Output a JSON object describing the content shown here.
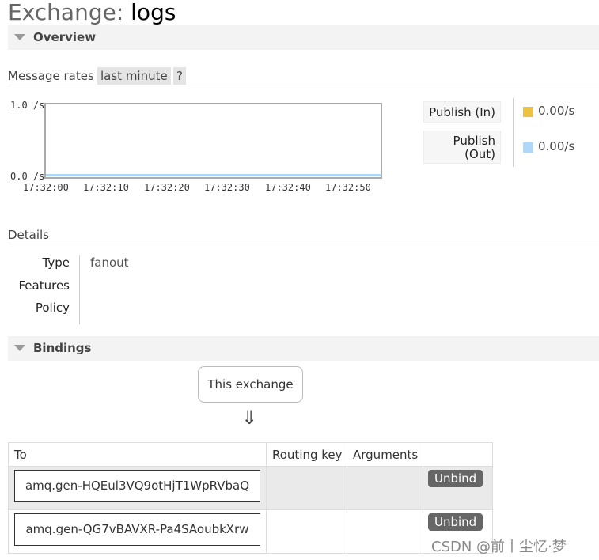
{
  "title": {
    "prefix": "Exchange: ",
    "name": "logs"
  },
  "sections": {
    "overview": "Overview",
    "bindings": "Bindings"
  },
  "message_rates": {
    "label": "Message rates",
    "period": "last minute",
    "help": "?",
    "y_ticks": [
      "1.0 /s",
      "0.0 /s"
    ],
    "x_ticks": [
      "17:32:00",
      "17:32:10",
      "17:32:20",
      "17:32:30",
      "17:32:40",
      "17:32:50"
    ],
    "legend": [
      {
        "label_line1": "Publish (In)",
        "label_line2": "",
        "color": "#edc240",
        "rate": "0.00/s"
      },
      {
        "label_line1": "Publish",
        "label_line2": "(Out)",
        "color": "#afd8f8",
        "rate": "0.00/s"
      }
    ]
  },
  "details": {
    "label": "Details",
    "rows": [
      {
        "label": "Type",
        "value": "fanout"
      },
      {
        "label": "Features",
        "value": ""
      },
      {
        "label": "Policy",
        "value": ""
      }
    ]
  },
  "bindings": {
    "source": "This exchange",
    "arrow": "⇓",
    "headers": [
      "To",
      "Routing key",
      "Arguments",
      ""
    ],
    "rows": [
      {
        "queue": "amq.gen-HQEul3VQ9otHjT1WpRVbaQ",
        "routing_key": "",
        "arguments": "",
        "action": "Unbind"
      },
      {
        "queue": "amq.gen-QG7vBAVXR-Pa4SAoubkXrw",
        "routing_key": "",
        "arguments": "",
        "action": "Unbind"
      }
    ]
  },
  "watermark": "CSDN @前丨尘忆·梦"
}
